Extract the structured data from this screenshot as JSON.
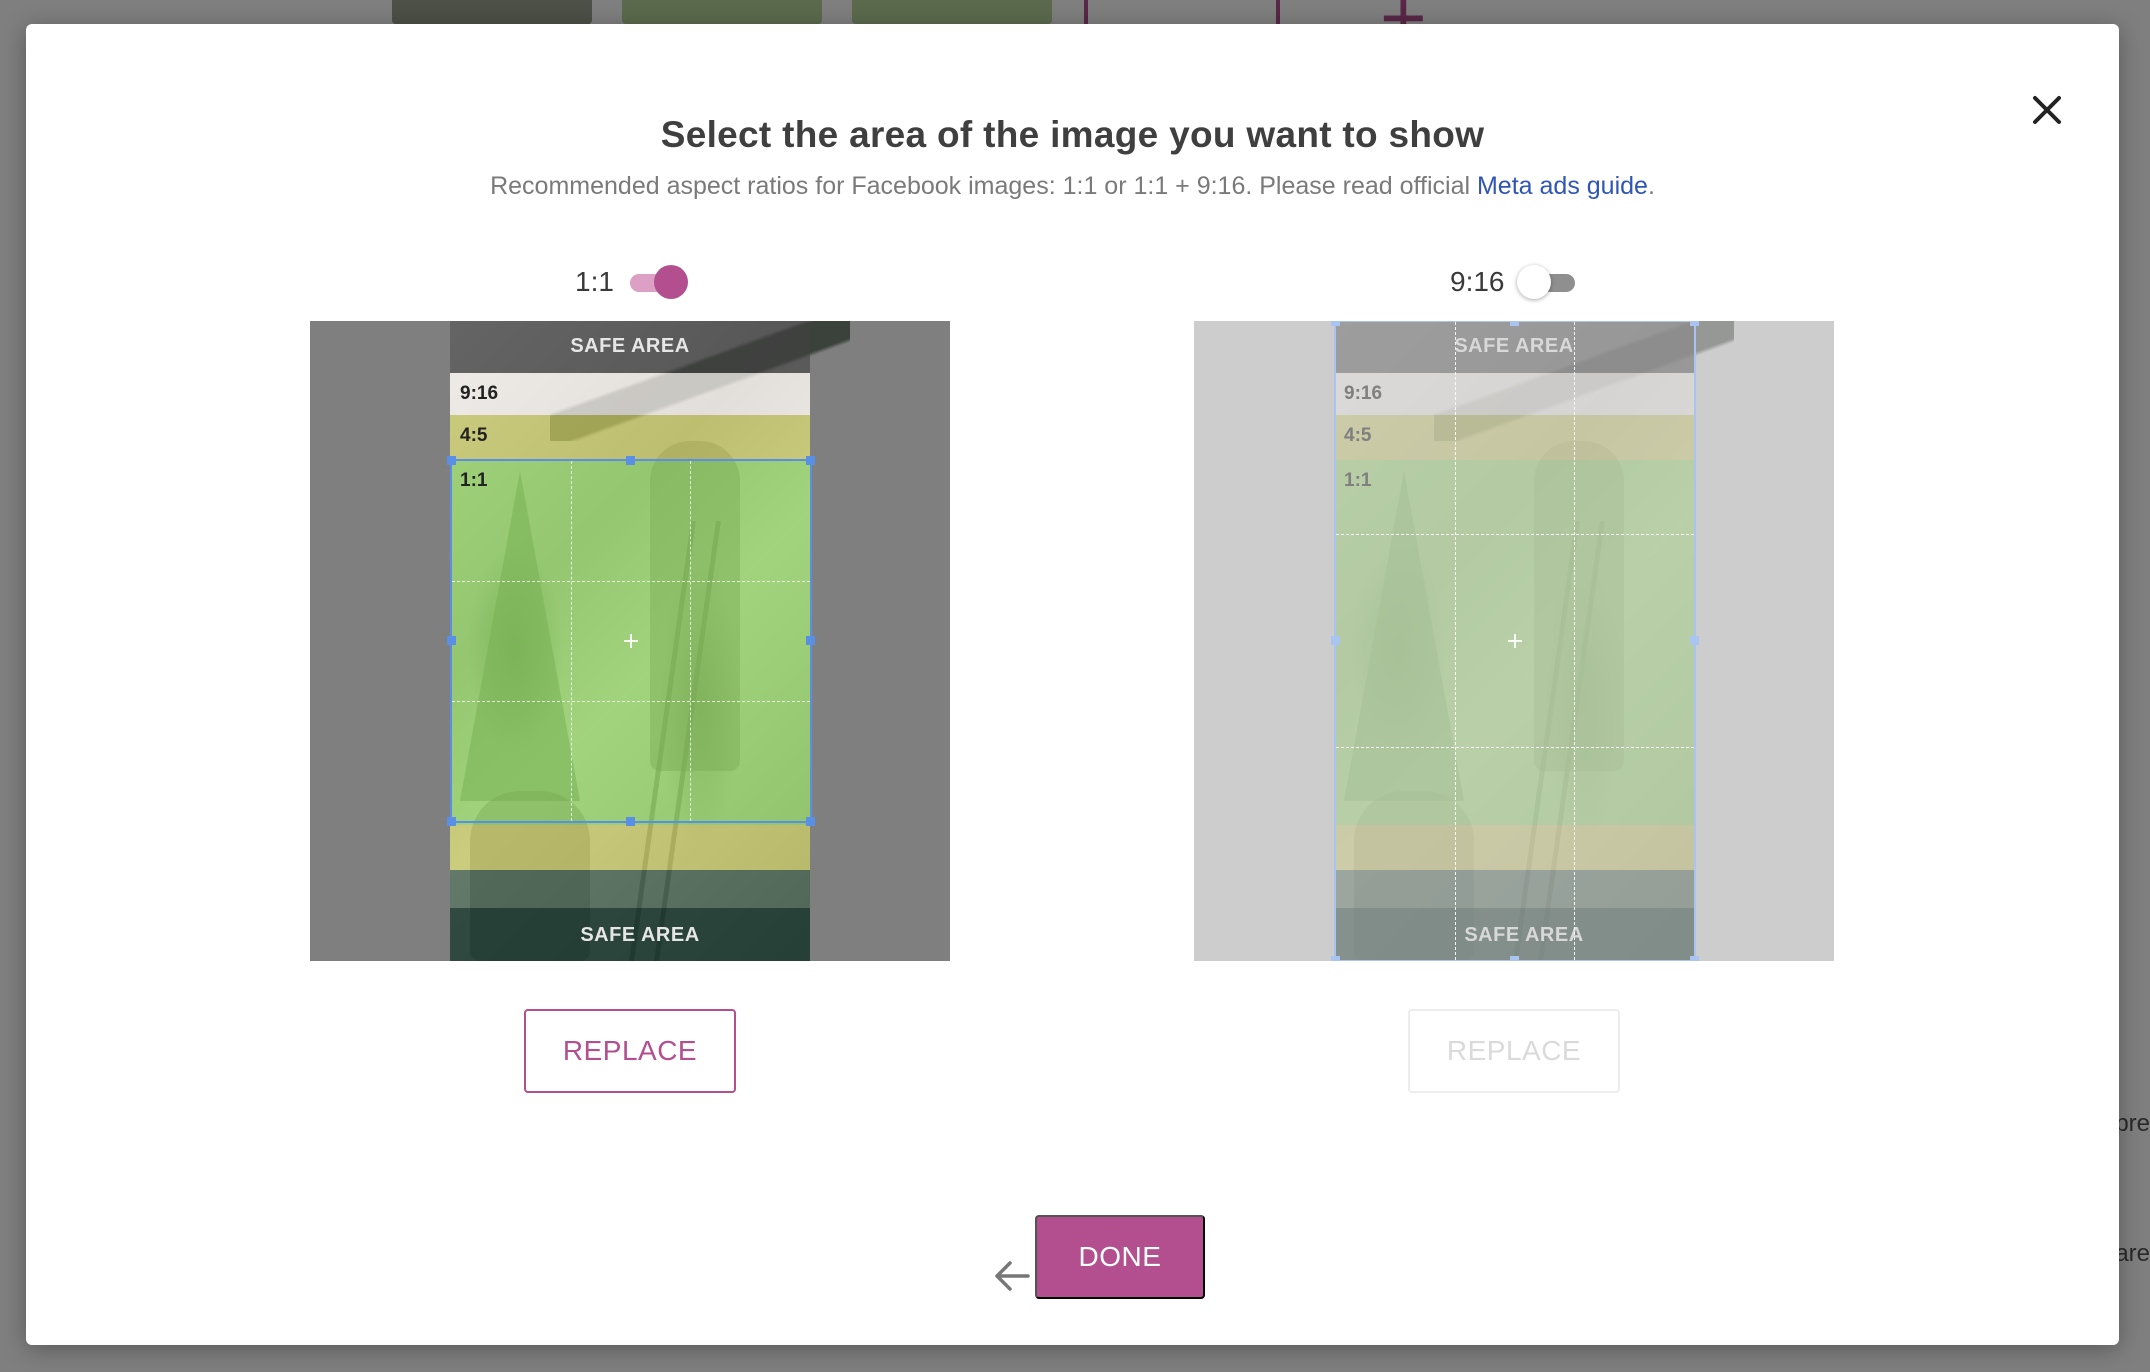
{
  "background": {
    "side_text_1": "pre",
    "side_text_2": "are"
  },
  "modal": {
    "title": "Select the area of the image you want to show",
    "subtitle_text": "Recommended aspect ratios for Facebook images: 1:1 or 1:1 + 9:16. Please read official ",
    "subtitle_link": "Meta ads guide",
    "subtitle_end": "."
  },
  "panels": [
    {
      "toggle_label": "1:1",
      "toggle_on": true,
      "bands": {
        "safe_top": "SAFE AREA",
        "r916": "9:16",
        "r45": "4:5",
        "r11": "1:1",
        "safe_bottom": "SAFE AREA"
      },
      "replace_label": "REPLACE",
      "enabled": true
    },
    {
      "toggle_label": "9:16",
      "toggle_on": false,
      "bands": {
        "safe_top": "SAFE AREA",
        "r916": "9:16",
        "r45": "4:5",
        "r11": "1:1",
        "safe_bottom": "SAFE AREA"
      },
      "replace_label": "REPLACE",
      "enabled": false
    }
  ],
  "footer": {
    "done_label": "DONE"
  },
  "icons": {
    "close": "close-icon",
    "back": "arrow-left-icon",
    "add": "plus-icon"
  },
  "colors": {
    "accent": "#b34e8f",
    "link": "#2f55b5",
    "crop_border": "#5a8fe6"
  }
}
